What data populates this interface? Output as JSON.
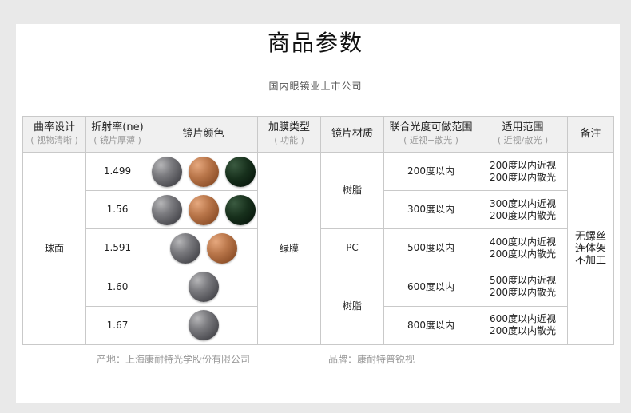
{
  "header": {
    "title": "商品参数",
    "subtitle": "国内眼镜业上市公司"
  },
  "table": {
    "columns": [
      {
        "main": "曲率设计",
        "sub": "( 视物清晰 )"
      },
      {
        "main": "折射率(ne)",
        "sub": "( 镜片厚薄 )"
      },
      {
        "main": "镜片颜色",
        "sub": ""
      },
      {
        "main": "加膜类型",
        "sub": "( 功能 )"
      },
      {
        "main": "镜片材质",
        "sub": ""
      },
      {
        "main": "联合光度可做范围",
        "sub": "( 近视+散光 )"
      },
      {
        "main": "适用范围",
        "sub": "( 近视/散光 )"
      },
      {
        "main": "备注",
        "sub": ""
      }
    ],
    "design": "球面",
    "coating": "绿膜",
    "note_lines": [
      "无螺丝",
      "连体架",
      "不加工"
    ],
    "rows": [
      {
        "index": "1.499",
        "colors": [
          "gray",
          "brown",
          "green"
        ],
        "combined": "200度以内",
        "scope": [
          "200度以内近视",
          "200度以内散光"
        ]
      },
      {
        "index": "1.56",
        "colors": [
          "gray",
          "brown",
          "green"
        ],
        "combined": "300度以内",
        "scope": [
          "300度以内近视",
          "200度以内散光"
        ]
      },
      {
        "index": "1.591",
        "colors": [
          "gray",
          "brown"
        ],
        "combined": "500度以内",
        "scope": [
          "400度以内近视",
          "200度以内散光"
        ]
      },
      {
        "index": "1.60",
        "colors": [
          "gray"
        ],
        "combined": "600度以内",
        "scope": [
          "500度以内近视",
          "200度以内散光"
        ]
      },
      {
        "index": "1.67",
        "colors": [
          "gray"
        ],
        "combined": "800度以内",
        "scope": [
          "600度以内近视",
          "200度以内散光"
        ]
      }
    ],
    "materials": [
      {
        "label": "树脂"
      },
      {
        "label": "PC"
      },
      {
        "label": "树脂"
      }
    ]
  },
  "footer": {
    "origin": "产地：上海康耐特光学股份有限公司",
    "brand": "品牌：康耐特普锐视"
  }
}
